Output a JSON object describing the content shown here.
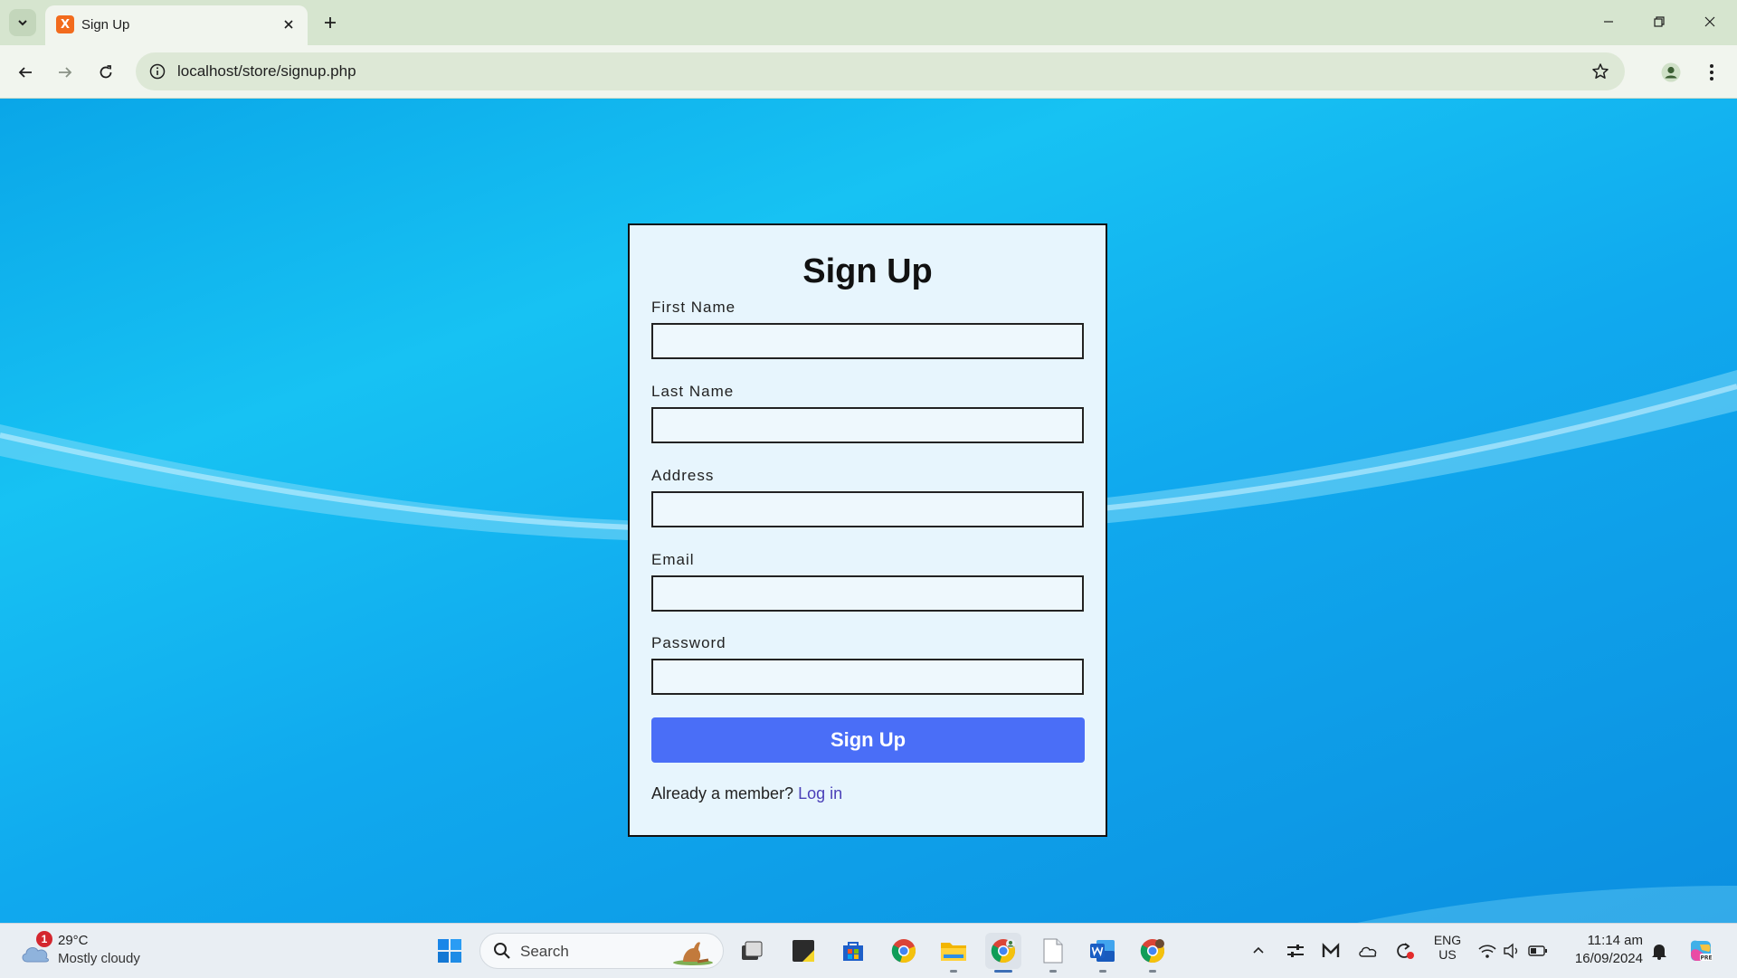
{
  "browser": {
    "tab_title": "Sign Up",
    "url": "localhost/store/signup.php"
  },
  "form": {
    "title": "Sign Up",
    "fields": [
      {
        "label": "First Name",
        "value": ""
      },
      {
        "label": "Last Name",
        "value": ""
      },
      {
        "label": "Address",
        "value": ""
      },
      {
        "label": "Email",
        "value": ""
      },
      {
        "label": "Password",
        "value": ""
      }
    ],
    "submit_label": "Sign Up",
    "member_prompt": "Already a member?",
    "login_link": "Log in"
  },
  "taskbar": {
    "weather_temp": "29°C",
    "weather_desc": "Mostly cloudy",
    "weather_badge": "1",
    "search_label": "Search",
    "lang_top": "ENG",
    "lang_bottom": "US",
    "time": "11:14 am",
    "date": "16/09/2024"
  },
  "colors": {
    "accent_button": "#4a6ef7",
    "card_background": "#e7f5fd",
    "login_link": "#4a3fb8",
    "tab_strip": "#d6e5cf"
  }
}
